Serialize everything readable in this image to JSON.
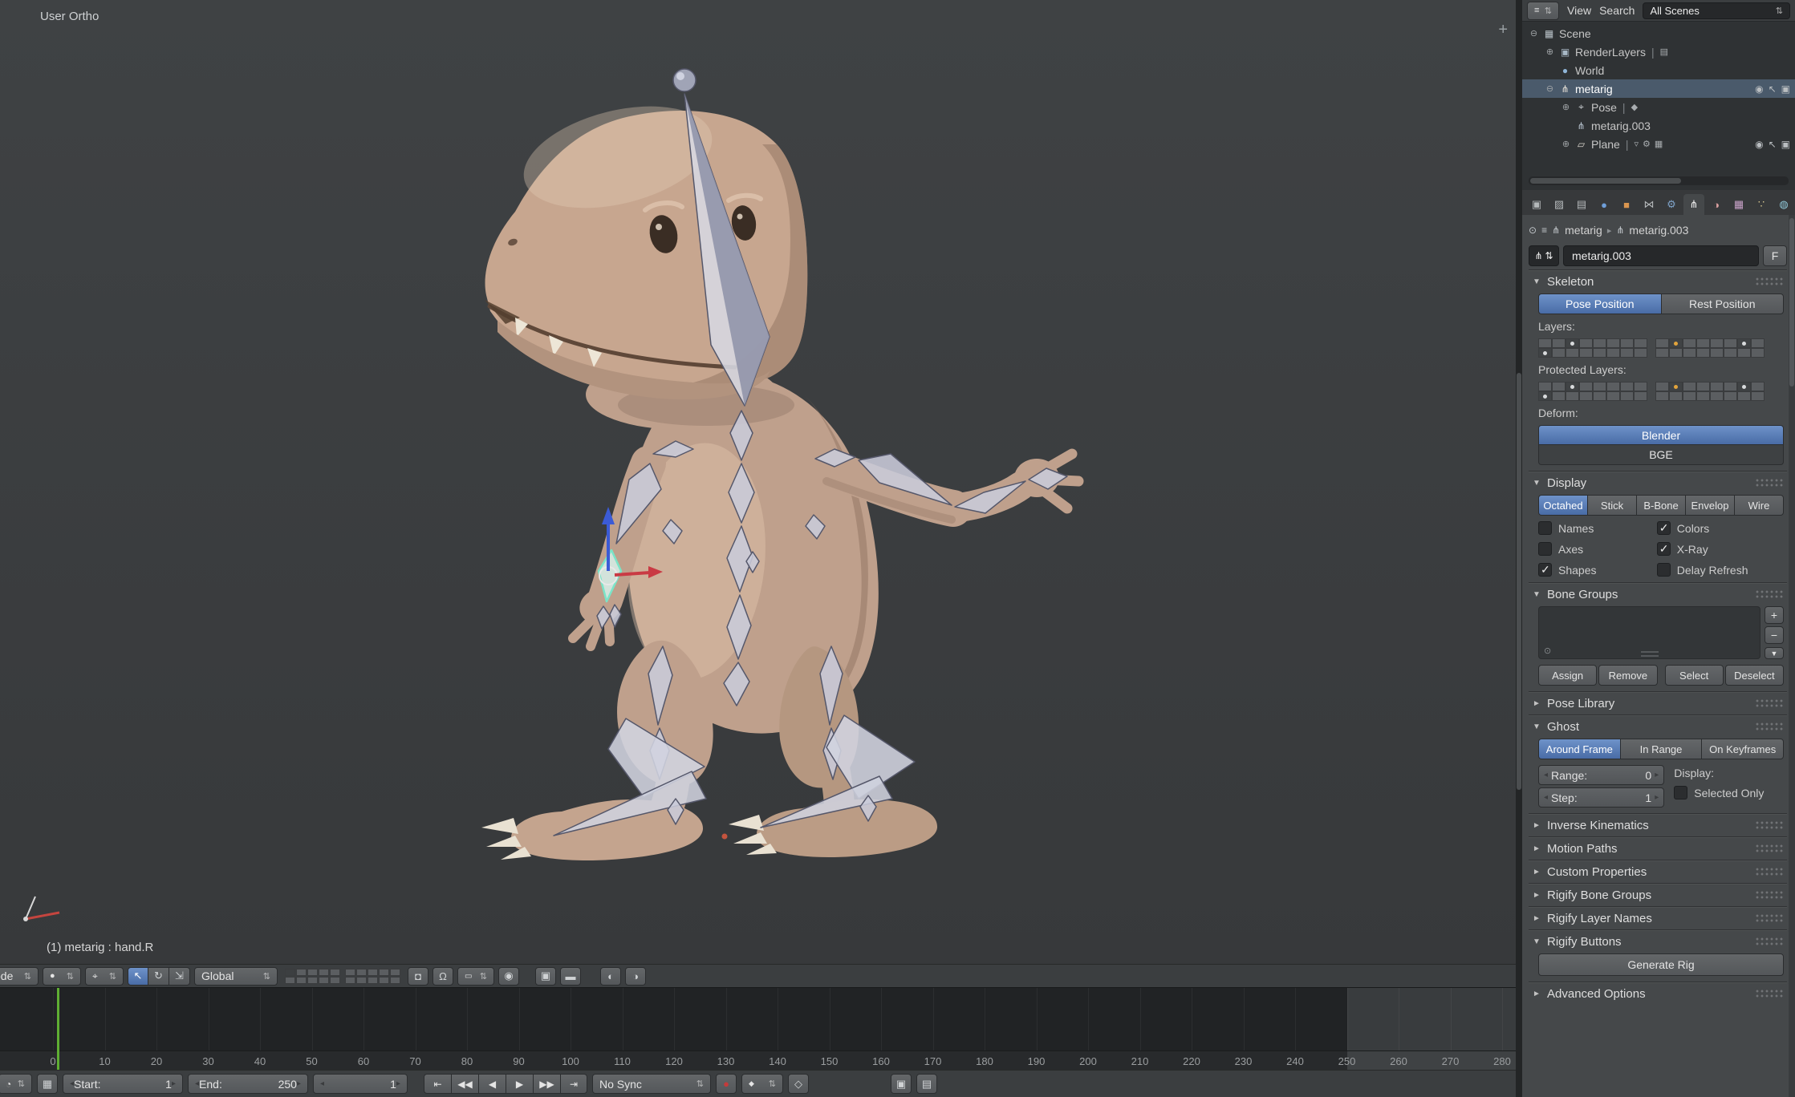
{
  "colors": {
    "accent_blue": "#4a6fae",
    "selected_bone": "#7be4c8",
    "current_frame_green": "#5fae33",
    "skin": "#bfa08c"
  },
  "viewport": {
    "view_label": "User Ortho",
    "status_text": "(1) metarig : hand.R",
    "header": {
      "mode_clipped": "ode",
      "orientation": "Global"
    }
  },
  "outliner": {
    "menu_view": "View",
    "menu_search": "Search",
    "scenes_selector": "All Scenes",
    "items": [
      {
        "label": "Scene"
      },
      {
        "label": "RenderLayers"
      },
      {
        "label": "World"
      },
      {
        "label": "metarig"
      },
      {
        "label": "Pose"
      },
      {
        "label": "metarig.003"
      },
      {
        "label": "Plane"
      }
    ]
  },
  "properties": {
    "breadcrumb": {
      "object": "metarig",
      "data": "metarig.003"
    },
    "name_value": "metarig.003",
    "fake_user": "F",
    "skeleton": {
      "title": "Skeleton",
      "pose_position": "Pose Position",
      "rest_position": "Rest Position",
      "layers_label": "Layers:",
      "protected_layers_label": "Protected Layers:",
      "deform_label": "Deform:",
      "deform_blender": "Blender",
      "deform_bge": "BGE",
      "layers_left": [
        [
          0,
          0,
          1,
          0,
          0,
          0,
          0,
          0
        ],
        [
          1,
          0,
          0,
          0,
          0,
          0,
          0,
          0
        ]
      ],
      "layers_right": [
        [
          0,
          2,
          0,
          0,
          0,
          0,
          1,
          0
        ],
        [
          0,
          0,
          0,
          0,
          0,
          0,
          0,
          0
        ]
      ],
      "protected_left": [
        [
          0,
          0,
          1,
          0,
          0,
          0,
          0,
          0
        ],
        [
          1,
          0,
          0,
          0,
          0,
          0,
          0,
          0
        ]
      ],
      "protected_right": [
        [
          0,
          2,
          0,
          0,
          0,
          0,
          1,
          0
        ],
        [
          0,
          0,
          0,
          0,
          0,
          0,
          0,
          0
        ]
      ]
    },
    "display": {
      "title": "Display",
      "draw_types": [
        {
          "label": "Octahed",
          "active": true
        },
        {
          "label": "Stick",
          "active": false
        },
        {
          "label": "B-Bone",
          "active": false
        },
        {
          "label": "Envelop",
          "active": false
        },
        {
          "label": "Wire",
          "active": false
        }
      ],
      "options": [
        {
          "label": "Names",
          "checked": false
        },
        {
          "label": "Colors",
          "checked": true
        },
        {
          "label": "Axes",
          "checked": false
        },
        {
          "label": "X-Ray",
          "checked": true
        },
        {
          "label": "Shapes",
          "checked": true
        },
        {
          "label": "Delay Refresh",
          "checked": false
        }
      ]
    },
    "bone_groups": {
      "title": "Bone Groups",
      "assign": "Assign",
      "remove": "Remove",
      "select": "Select",
      "deselect": "Deselect"
    },
    "pose_library_title": "Pose Library",
    "ghost": {
      "title": "Ghost",
      "types": [
        {
          "label": "Around Frame",
          "active": true
        },
        {
          "label": "In Range",
          "active": false
        },
        {
          "label": "On Keyframes",
          "active": false
        }
      ],
      "range_label": "Range:",
      "range_value": "0",
      "step_label": "Step:",
      "step_value": "1",
      "display_label": "Display:",
      "selected_only": "Selected Only"
    },
    "collapsed_panels": [
      {
        "title": "Inverse Kinematics"
      },
      {
        "title": "Motion Paths"
      },
      {
        "title": "Custom Properties"
      },
      {
        "title": "Rigify Bone Groups"
      },
      {
        "title": "Rigify Layer Names"
      }
    ],
    "rigify": {
      "title": "Rigify Buttons",
      "generate": "Generate Rig",
      "advanced": "Advanced Options"
    }
  },
  "timeline": {
    "ticks": [
      "0",
      "10",
      "20",
      "30",
      "40",
      "50",
      "60",
      "70",
      "80",
      "90",
      "100",
      "110",
      "120",
      "130",
      "140",
      "150",
      "160",
      "170",
      "180",
      "190",
      "200",
      "210",
      "220",
      "230",
      "240",
      "250",
      "260",
      "270",
      "280"
    ],
    "footer": {
      "start_label": "Start:",
      "start_value": "1",
      "end_label": "End:",
      "end_value": "250",
      "frame_value": "1",
      "sync": "No Sync"
    }
  }
}
